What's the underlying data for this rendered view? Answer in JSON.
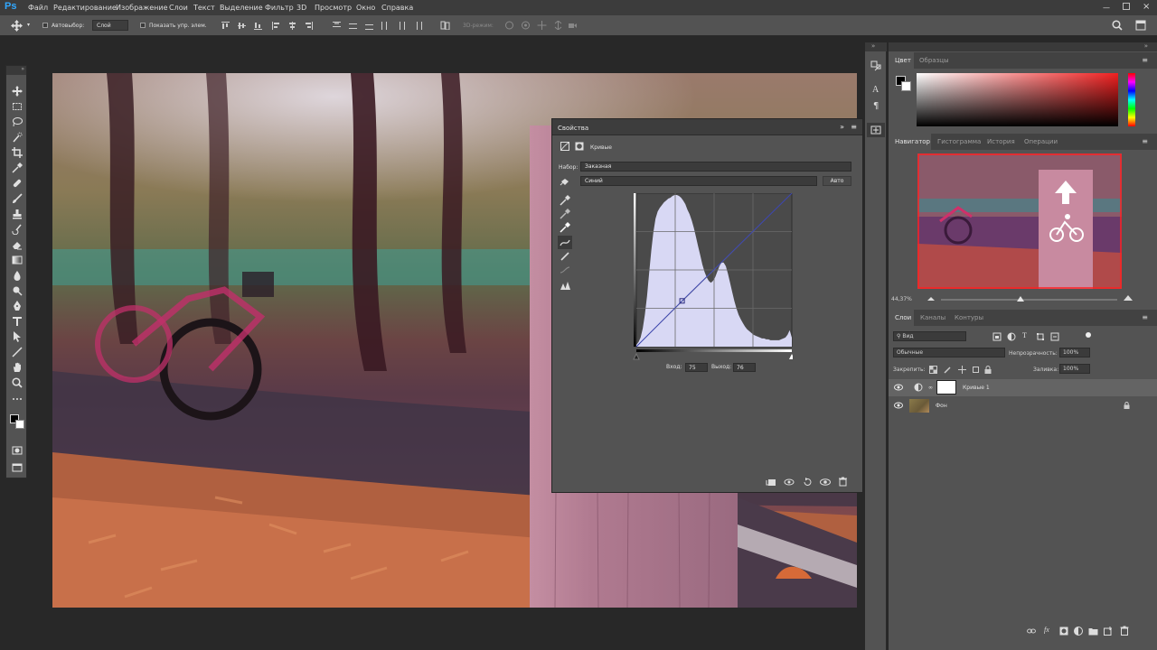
{
  "app": {
    "logo": "Ps"
  },
  "menu": [
    "Файл",
    "Редактирование",
    "Изображение",
    "Слои",
    "Текст",
    "Выделение",
    "Фильтр",
    "3D",
    "Просмотр",
    "Окно",
    "Справка"
  ],
  "options": {
    "autoselect": "Автовыбор:",
    "autoselect_value": "Слой",
    "show_controls": "Показать упр. элем.",
    "mode_3d": "3D-режим:"
  },
  "properties": {
    "title": "Свойства",
    "adjustment": "Кривые",
    "preset_label": "Набор:",
    "preset_value": "Заказная",
    "channel_value": "Синий",
    "auto_button": "Авто",
    "input_label": "Вход:",
    "input_value": "75",
    "output_label": "Выход:",
    "output_value": "76",
    "curve_point": {
      "input": 75,
      "output": 76
    },
    "histogram": [
      2,
      5,
      10,
      20,
      35,
      55,
      80,
      105,
      125,
      140,
      148,
      152,
      155,
      158,
      160,
      162,
      163,
      165,
      166,
      166,
      165,
      163,
      160,
      156,
      150,
      145,
      138,
      130,
      120,
      110,
      100,
      90,
      82,
      76,
      72,
      70,
      72,
      76,
      82,
      88,
      92,
      92,
      88,
      80,
      70,
      60,
      50,
      42,
      35,
      30,
      26,
      22,
      19,
      17,
      15,
      13,
      12,
      11,
      10,
      9,
      9,
      8,
      8,
      7,
      7,
      7,
      7,
      7,
      8,
      9,
      10,
      13,
      18,
      10
    ],
    "curve_color": "#3a44b0",
    "histogram_color": "#d8d8f4"
  },
  "panels": {
    "color_tabs": [
      "Цвет",
      "Образцы"
    ],
    "nav_tabs": [
      "Навигатор",
      "Гистограмма",
      "История",
      "Операции"
    ],
    "zoom": "44,37%",
    "layers_tabs": [
      "Слои",
      "Каналы",
      "Контуры"
    ],
    "filter": "Вид",
    "blend": "Обычные",
    "opacity_label": "Непрозрачность:",
    "opacity": "100%",
    "lock_label": "Закрепить:",
    "fill_label": "Заливка:",
    "fill": "100%",
    "layers": [
      {
        "name": "Кривые 1",
        "kind": "adjustment",
        "selected": true
      },
      {
        "name": "Фон",
        "kind": "background",
        "selected": false
      }
    ]
  },
  "colors": {
    "accent": "#31a8ff",
    "selection": "#646464"
  }
}
